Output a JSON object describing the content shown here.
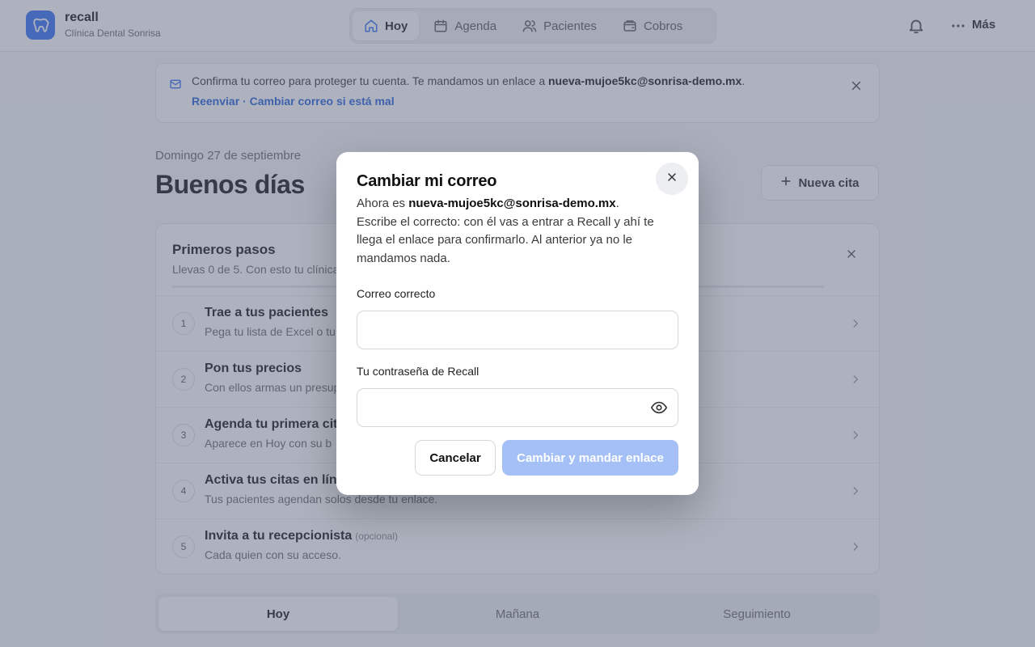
{
  "app": {
    "name": "recall",
    "clinic": "Clínica Dental Sonrisa",
    "accent": "#2f6df6"
  },
  "nav": {
    "tabs": [
      {
        "label": "Hoy",
        "icon": "home-icon",
        "active": true
      },
      {
        "label": "Agenda",
        "icon": "calendar-icon",
        "active": false
      },
      {
        "label": "Pacientes",
        "icon": "users-icon",
        "active": false
      },
      {
        "label": "Cobros",
        "icon": "wallet-icon",
        "active": false
      }
    ],
    "more_label": "Más"
  },
  "banner": {
    "text": "Confirma tu correo para proteger tu cuenta. Te mandamos un enlace a ",
    "email": "nueva-mujoe5kc@sonrisa-demo.mx",
    "text_end": ".",
    "resend": "Reenviar",
    "separator": " · ",
    "change": "Cambiar correo si está mal"
  },
  "header": {
    "date": "Domingo 27 de septiembre",
    "greeting": "Buenos días",
    "new_appointment": "Nueva cita"
  },
  "onboarding": {
    "title": "Primeros pasos",
    "subtitle": "Llevas 0 de 5. Con esto tu clínica",
    "progress": 0,
    "steps": [
      {
        "num": "1",
        "title": "Trae a tus pacientes",
        "desc": "Pega tu lista de Excel o tu"
      },
      {
        "num": "2",
        "title": "Pon tus precios",
        "desc": "Con ellos armas un presup"
      },
      {
        "num": "3",
        "title": "Agenda tu primera cita",
        "desc": "Aparece en Hoy con su b"
      },
      {
        "num": "4",
        "title": "Activa tus citas en lín",
        "desc": "Tus pacientes agendan solos desde tu enlace."
      },
      {
        "num": "5",
        "title": "Invita a tu recepcionista",
        "optional": "(opcional)",
        "desc": "Cada quien con su acceso."
      }
    ]
  },
  "segmented": {
    "tabs": [
      "Hoy",
      "Mañana",
      "Seguimiento"
    ],
    "active": 0
  },
  "modal": {
    "title": "Cambiar mi correo",
    "desc_prefix": "Ahora es ",
    "current_email": "nueva-mujoe5kc@sonrisa-demo.mx",
    "desc_suffix": ". Escribe el correcto: con él vas a entrar a Recall y ahí te llega el enlace para confirmarlo. Al anterior ya no le mandamos nada.",
    "email_label": "Correo correcto",
    "email_value": "",
    "password_label": "Tu contraseña de Recall",
    "password_value": "",
    "cancel": "Cancelar",
    "submit": "Cambiar y mandar enlace",
    "submit_color": "#a4c0f6"
  }
}
